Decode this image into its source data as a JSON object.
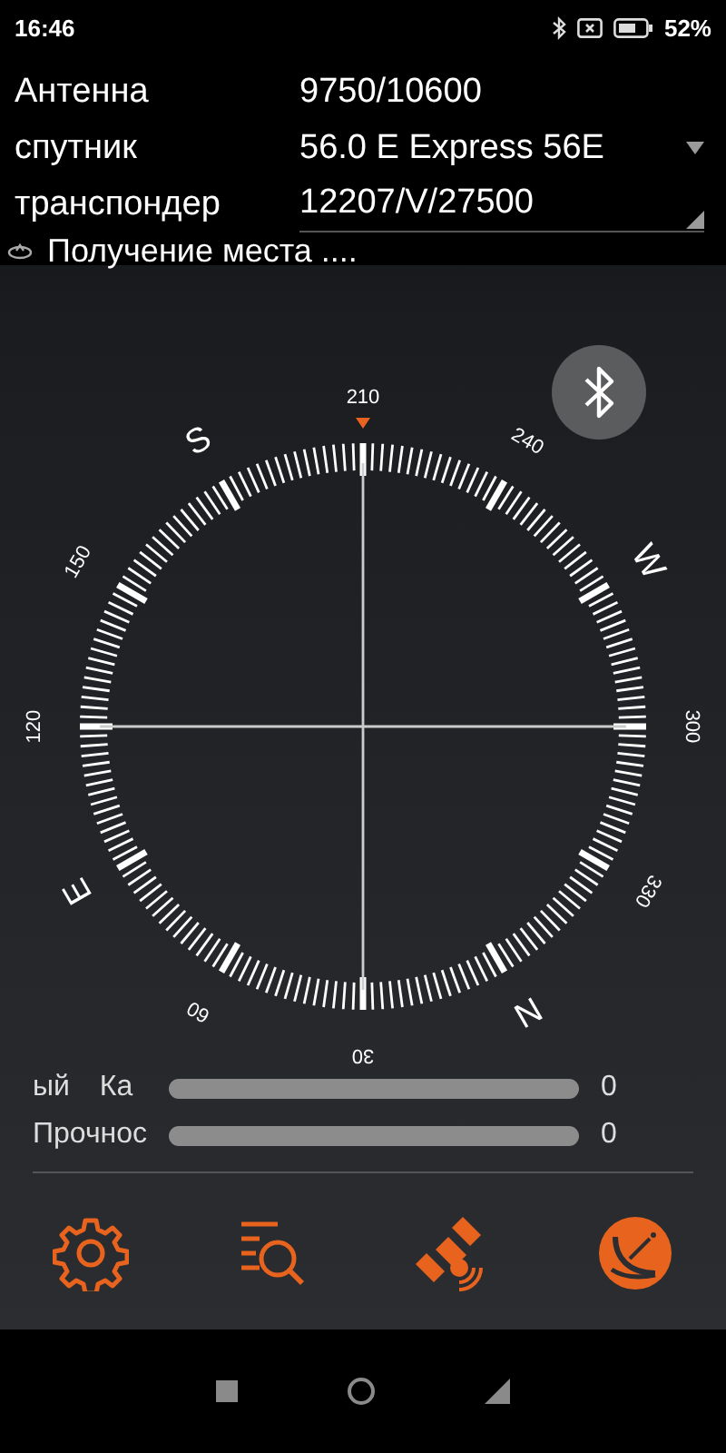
{
  "status_bar": {
    "time": "16:46",
    "battery": "52%"
  },
  "settings": [
    {
      "label": "Антенна",
      "value": "9750/10600",
      "kind": "plain"
    },
    {
      "label": "спутник",
      "value": "56.0 E Express 56E",
      "kind": "dropdown"
    },
    {
      "label": "транспондер",
      "value": "12207/V/27500",
      "kind": "spinner"
    }
  ],
  "location_status": "Получение места ....",
  "compass": {
    "labels": [
      {
        "text": "N",
        "selected": false
      },
      {
        "text": "30",
        "selected": false
      },
      {
        "text": "60",
        "selected": false
      },
      {
        "text": "E",
        "selected": false
      },
      {
        "text": "120",
        "selected": false
      },
      {
        "text": "150",
        "selected": false
      },
      {
        "text": "S",
        "selected": false
      },
      {
        "text": "210",
        "selected": true
      },
      {
        "text": "240",
        "selected": false
      },
      {
        "text": "W",
        "selected": false
      },
      {
        "text": "300",
        "selected": false
      },
      {
        "text": "330",
        "selected": false
      }
    ]
  },
  "meters": [
    {
      "label": "ый Ка",
      "level": 0,
      "reading": "0"
    },
    {
      "label": "Прочнос",
      "level": 0,
      "reading": "0"
    }
  ]
}
